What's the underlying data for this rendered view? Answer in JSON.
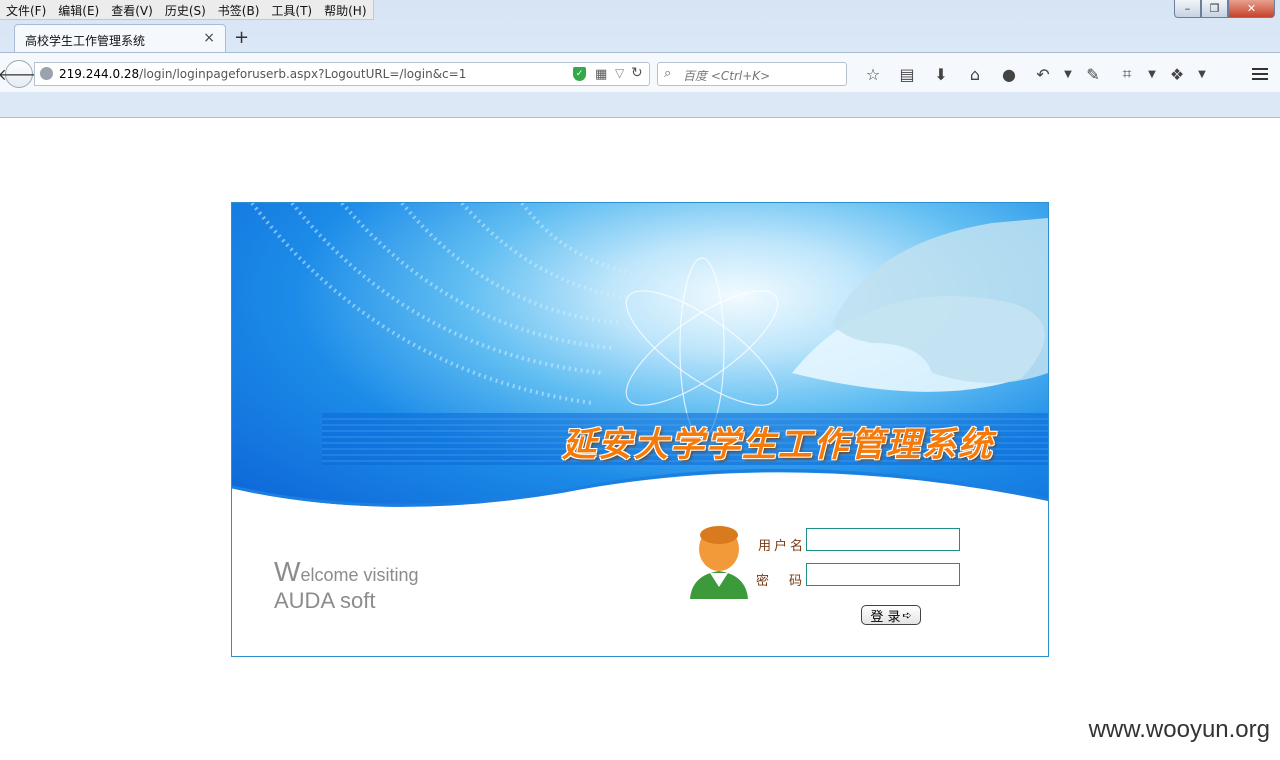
{
  "browser": {
    "menu": [
      "文件(F)",
      "编辑(E)",
      "查看(V)",
      "历史(S)",
      "书签(B)",
      "工具(T)",
      "帮助(H)"
    ],
    "tab_title": "高校学生工作管理系统",
    "tab_close": "×",
    "new_tab": "+",
    "url_host": "219.244.0.28",
    "url_path": "/login/loginpageforuserb.aspx?LogoutURL=/login&c=1",
    "search_placeholder": "百度 <Ctrl+K>"
  },
  "login": {
    "banner_title": "延安大学学生工作管理系统",
    "welcome_big_w": "W",
    "welcome_rest": "elcome visiting",
    "welcome_line2": "AUDA soft",
    "username_label": "用户名",
    "password_label": "密码",
    "username_value": "",
    "password_value": "",
    "login_button": "登 录"
  },
  "watermark": "www.wooyun.org",
  "colors": {
    "banner_title": "#f57a0a",
    "panel_border": "#2c8fd0",
    "label": "#7a3a14",
    "field_border": "#1d8f86"
  }
}
